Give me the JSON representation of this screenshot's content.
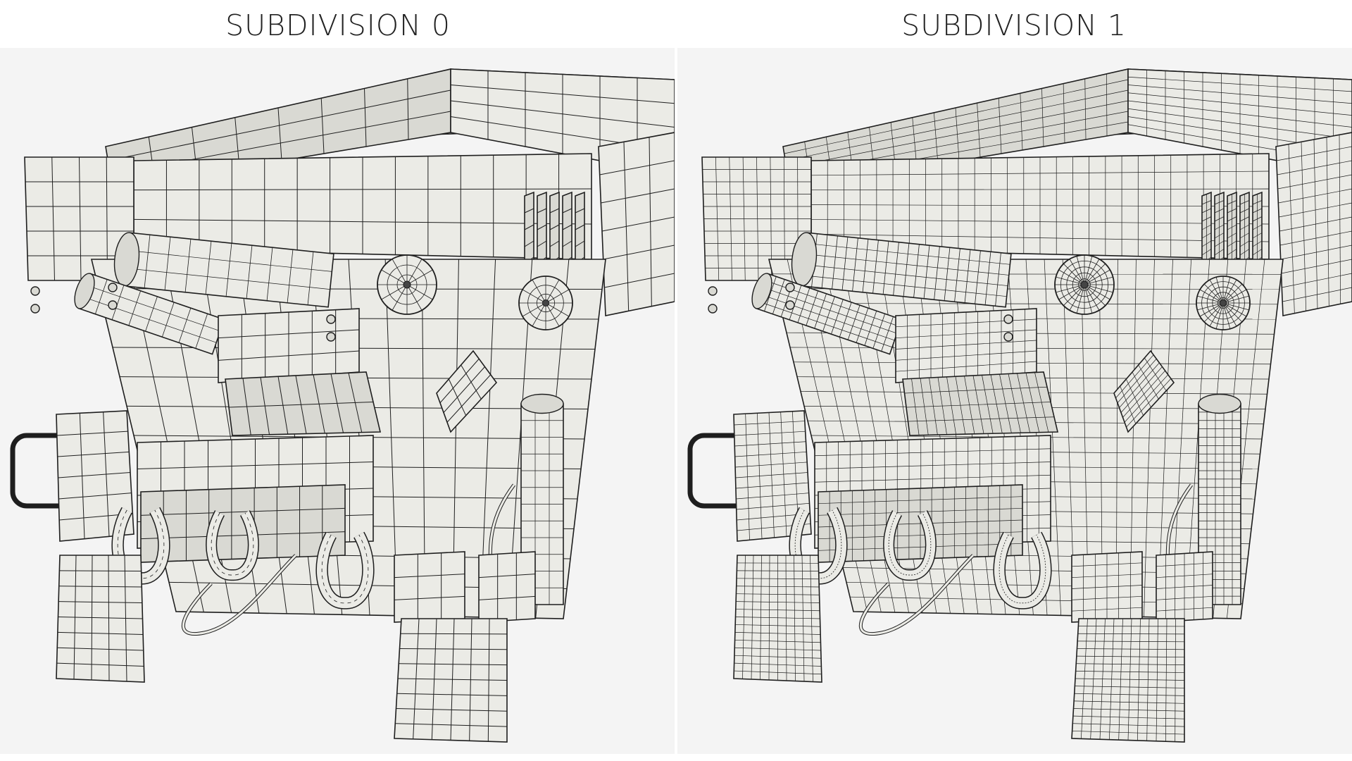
{
  "panels": [
    {
      "id": "left",
      "title": "SUBDIVISION 0",
      "subdivision_level": 0
    },
    {
      "id": "right",
      "title": "SUBDIVISION 1",
      "subdivision_level": 1
    }
  ],
  "colors": {
    "background": "#f4f4f4",
    "surface": "#ebebe6",
    "surface_dark": "#d9d9d3",
    "wire": "#1e1e1e"
  }
}
